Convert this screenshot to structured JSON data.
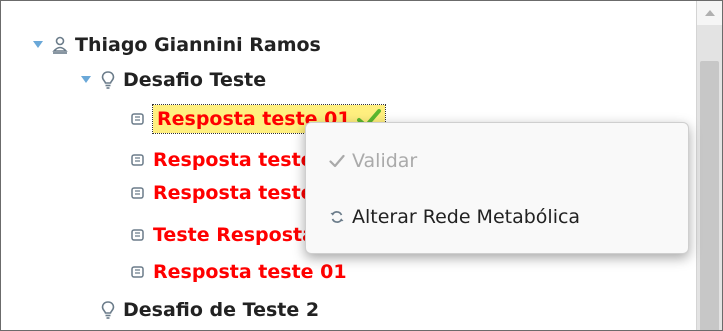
{
  "tree": {
    "root": {
      "label": "Thiago Giannini Ramos",
      "icon": "user-icon",
      "expanded": true
    },
    "challenges": [
      {
        "label": "Desafio Teste",
        "icon": "lightbulb-icon",
        "expanded": true,
        "answers": [
          {
            "label": "Resposta teste 01",
            "icon": "answer-icon",
            "selected": true,
            "validated": true
          },
          {
            "label": "Resposta teste 01",
            "icon": "answer-icon"
          },
          {
            "label": "Resposta teste 01",
            "icon": "answer-icon"
          },
          {
            "label": "Teste Resposta",
            "icon": "answer-icon"
          },
          {
            "label": "Resposta teste 01",
            "icon": "answer-icon"
          }
        ]
      },
      {
        "label": "Desafio de Teste 2",
        "icon": "lightbulb-icon",
        "expanded": false
      }
    ]
  },
  "context_menu": {
    "items": [
      {
        "label": "Validar",
        "icon": "check-icon",
        "enabled": false
      },
      {
        "label": "Alterar Rede Metabólica",
        "icon": "refresh-icon",
        "enabled": true
      }
    ]
  },
  "colors": {
    "answer_text": "#ff0000",
    "selected_background": "#ffef7f",
    "check": "#5cb82e"
  }
}
